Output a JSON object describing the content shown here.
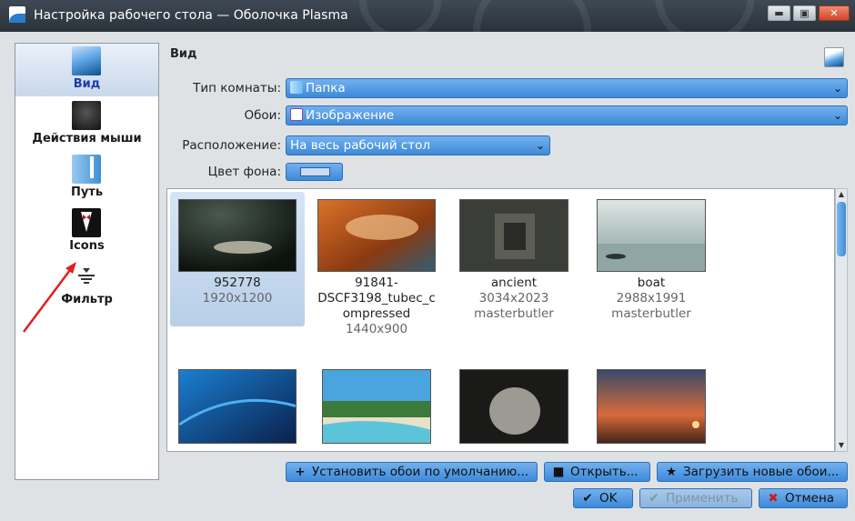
{
  "window": {
    "title": "Настройка рабочего стола — Оболочка Plasma",
    "buttons": {
      "minimize": "▬",
      "maximize": "▣",
      "close": "✕"
    }
  },
  "sidebar": {
    "items": [
      {
        "label": "Вид",
        "icon": "view-icon",
        "selected": true
      },
      {
        "label": "Действия мыши",
        "icon": "mouse-actions-icon",
        "selected": false
      },
      {
        "label": "Путь",
        "icon": "path-icon",
        "selected": false
      },
      {
        "label": "Icons",
        "icon": "icons-tuxedo-icon",
        "selected": false
      },
      {
        "label": "Фильтр",
        "icon": "filter-icon",
        "selected": false
      }
    ]
  },
  "main": {
    "header": "Вид",
    "fields": {
      "room_type": {
        "label": "Тип комнаты:",
        "value": "Папка"
      },
      "wallpaper": {
        "label": "Обои:",
        "value": "Изображение"
      },
      "placement": {
        "label": "Расположение:",
        "value": "На весь рабочий стол"
      },
      "bg_color": {
        "label": "Цвет фона:",
        "value": "#c8dbf3"
      }
    },
    "gallery": [
      {
        "name": "952778",
        "meta1": "1920x1200",
        "meta2": "",
        "selected": true
      },
      {
        "name": "91841-DSCF3198_tubec_compressed",
        "name_lines": [
          "91841-",
          "DSCF3198_tubec_c",
          "ompressed"
        ],
        "meta1": "1440x900",
        "meta2": ""
      },
      {
        "name": "ancient",
        "meta1": "3034x2023",
        "meta2": "masterbutler"
      },
      {
        "name": "boat",
        "meta1": "2988x1991",
        "meta2": "masterbutler"
      }
    ],
    "buttons": {
      "default_wallpaper": "Установить обои по умолчанию...",
      "open": "Открыть...",
      "download": "Загрузить новые обои..."
    }
  },
  "dialog_buttons": {
    "ok": "OK",
    "apply": "Применить",
    "cancel": "Отмена"
  },
  "colors": {
    "accent": "#3d8ad9",
    "selected_text": "#1b3db5",
    "annotation_arrow": "#e02020"
  }
}
